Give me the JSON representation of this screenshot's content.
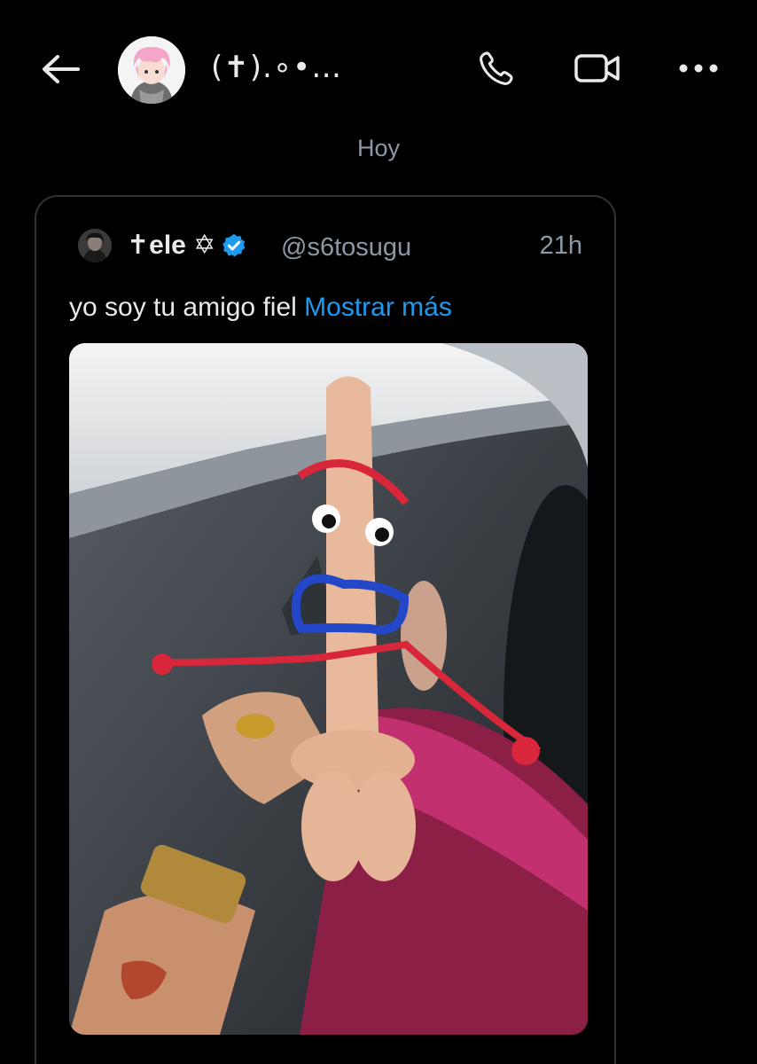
{
  "header": {
    "chat_name": "(✝).∘•…",
    "icons": {
      "back": "arrow-left-icon",
      "call": "phone-icon",
      "video": "video-camera-icon",
      "more": "more-horizontal-icon"
    }
  },
  "date_separator": "Hoy",
  "tweet": {
    "author_name": "✝ele ✡",
    "handle": "@s6tosugu",
    "time": "21h",
    "text": "yo soy tu amigo fiel",
    "show_more": "Mostrar más",
    "verified": true,
    "media_description": "photo of a decorated toy figure inside a car"
  },
  "colors": {
    "background": "#000000",
    "link": "#1d9bf0",
    "muted": "#8b98a5",
    "text": "#e7e9ea",
    "border": "#2f3336"
  }
}
